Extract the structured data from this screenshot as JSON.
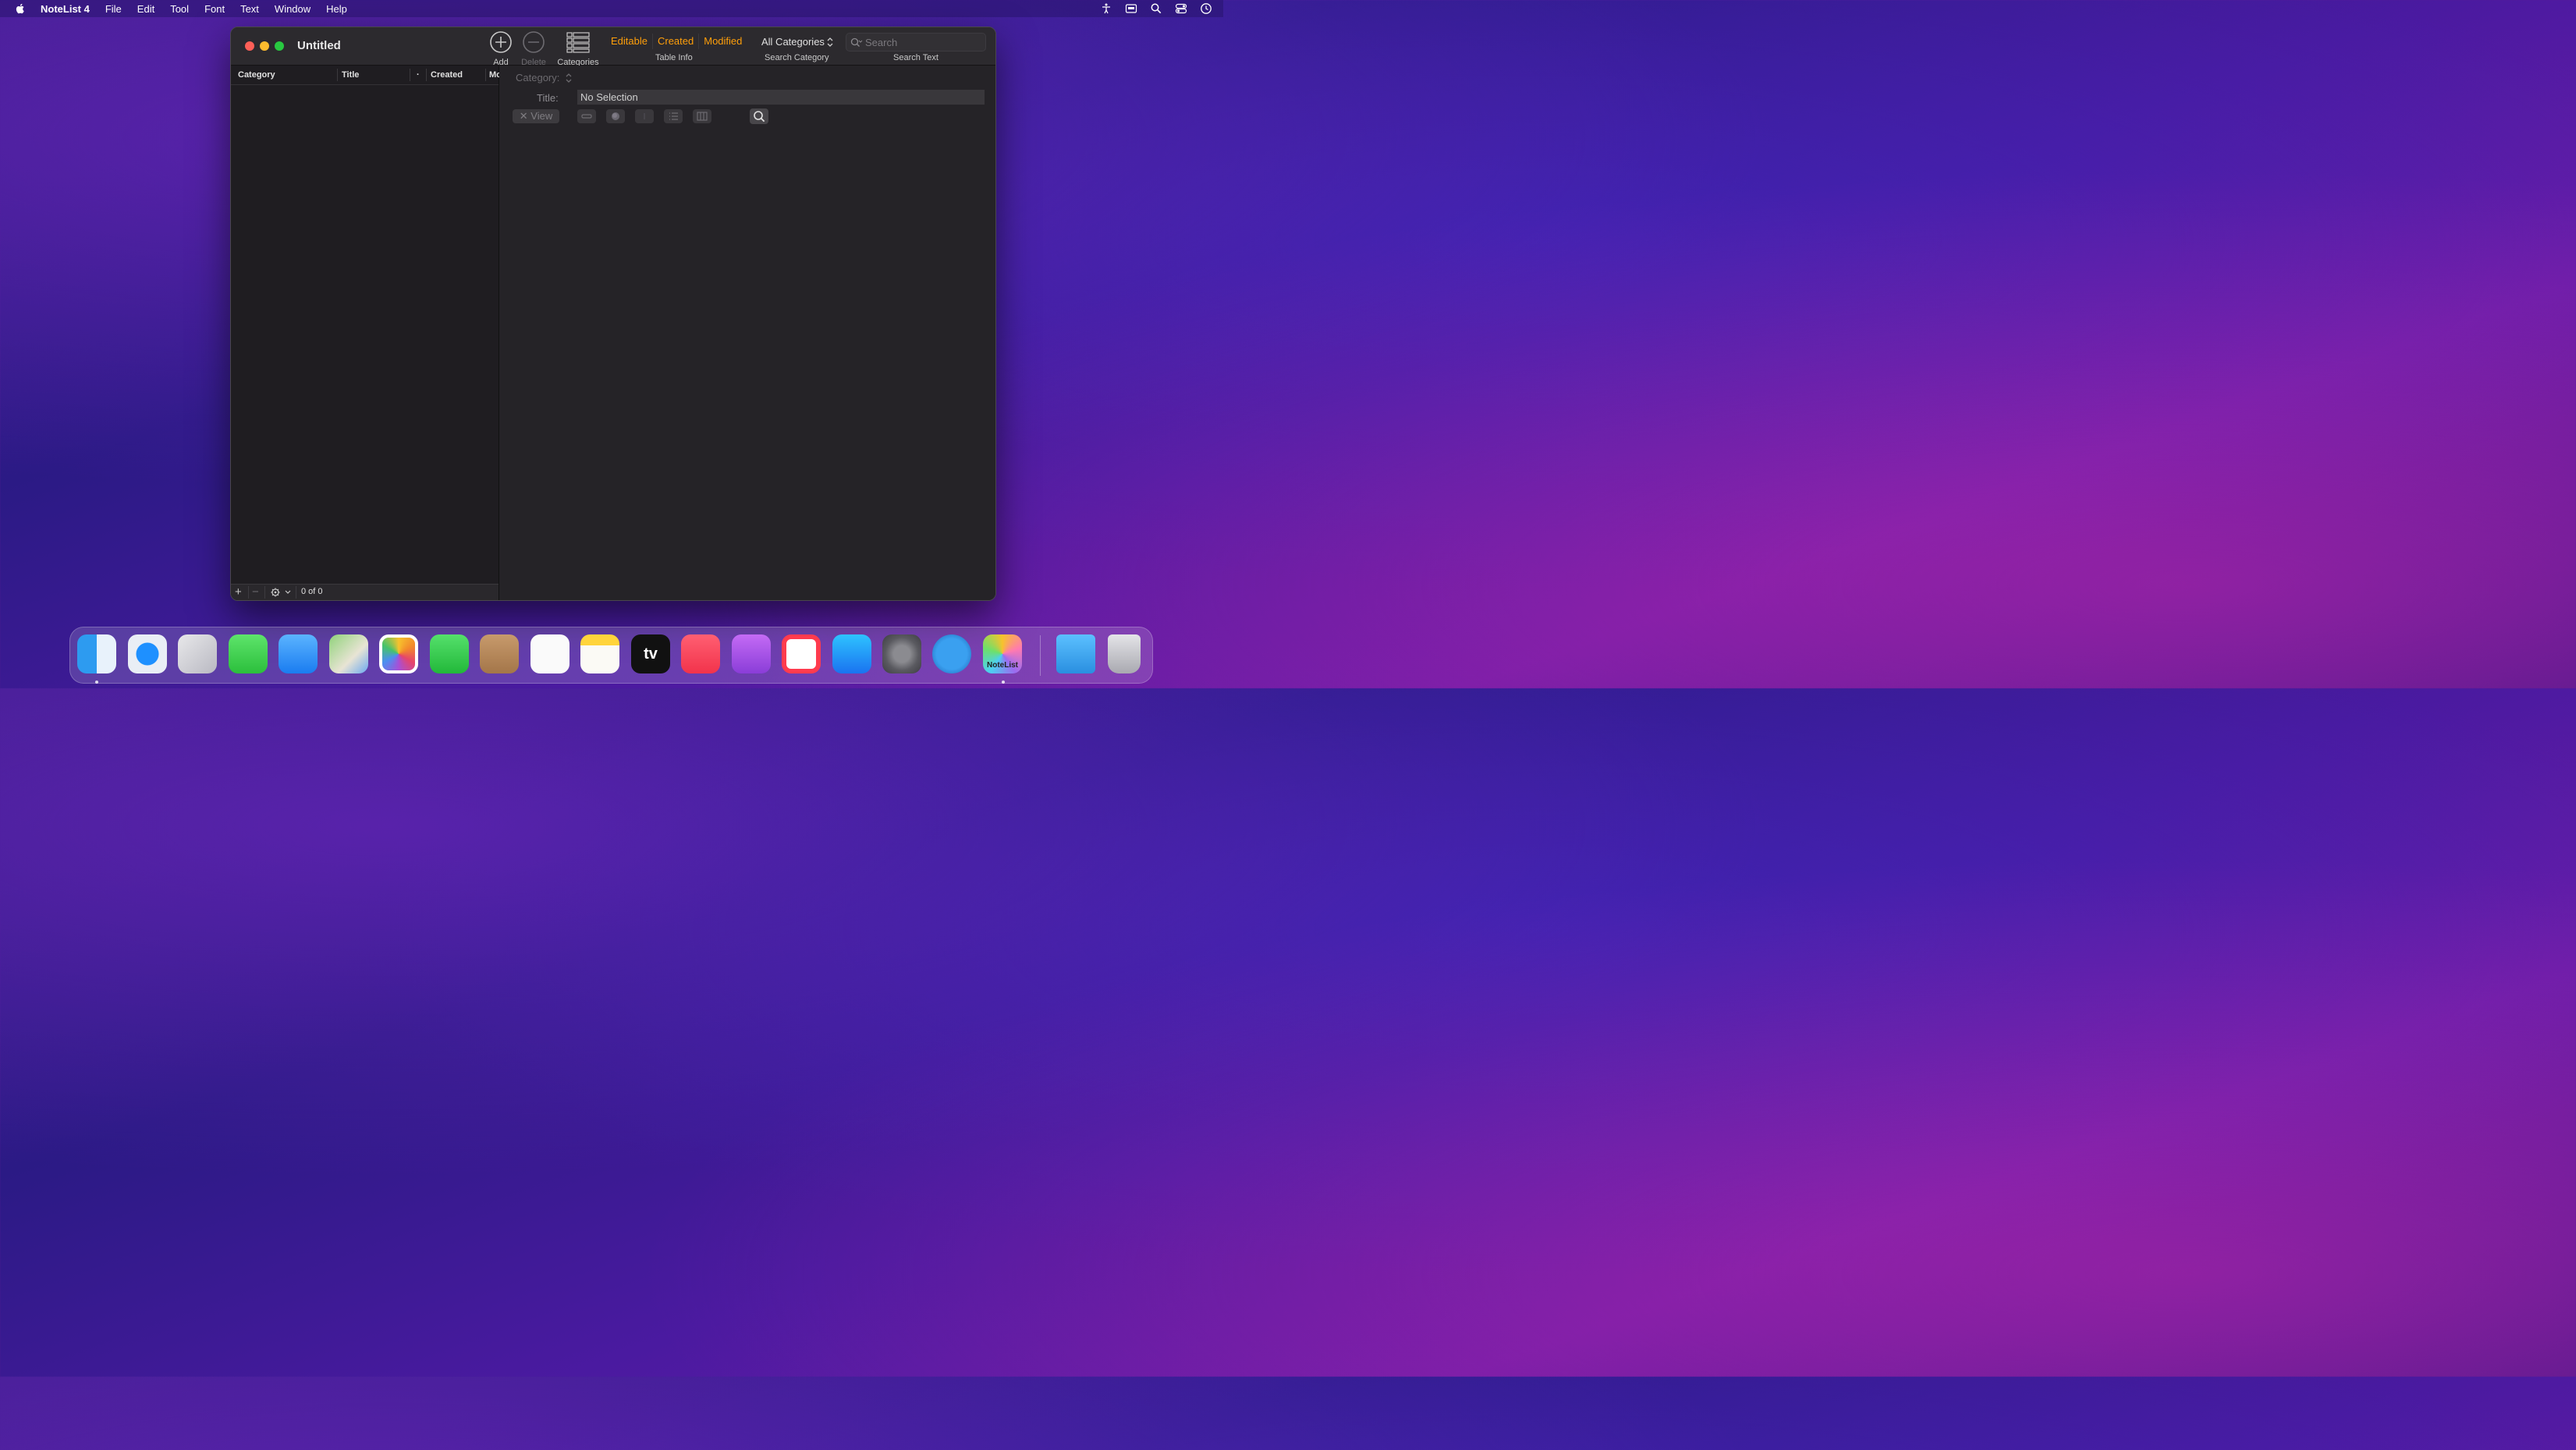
{
  "menubar": {
    "app_name": "NoteList 4",
    "items": [
      "File",
      "Edit",
      "Tool",
      "Font",
      "Text",
      "Window",
      "Help"
    ]
  },
  "window": {
    "title": "Untitled",
    "toolbar": {
      "add_label": "Add",
      "delete_label": "Delete",
      "categories_label": "Categories",
      "table_info_segments": [
        "Editable",
        "Created",
        "Modified"
      ],
      "table_info_label": "Table Info",
      "search_category_value": "All Categories",
      "search_category_label": "Search Category",
      "search_placeholder": "Search",
      "search_text_label": "Search Text"
    },
    "table": {
      "columns": [
        "Category",
        "Title",
        "·",
        "Created",
        "Mo"
      ],
      "footer_count": "0 of 0"
    },
    "detail": {
      "category_label": "Category:",
      "title_label": "Title:",
      "title_value": "No Selection",
      "view_button": "View"
    }
  },
  "dock": {
    "apps": [
      "Finder",
      "Safari",
      "Launchpad",
      "Messages",
      "Mail",
      "Maps",
      "Photos",
      "FaceTime",
      "Contacts",
      "Reminders",
      "Notes",
      "TV",
      "Music",
      "Podcasts",
      "News",
      "App Store",
      "System Preferences",
      "Mountain",
      "NoteList",
      "Folder",
      "Trash"
    ],
    "notelist_label": "NoteList"
  },
  "colors": {
    "accent_orange": "#ff9f0a",
    "close": "#fe5f57",
    "minimize": "#febc2e",
    "maximize": "#28c840"
  }
}
